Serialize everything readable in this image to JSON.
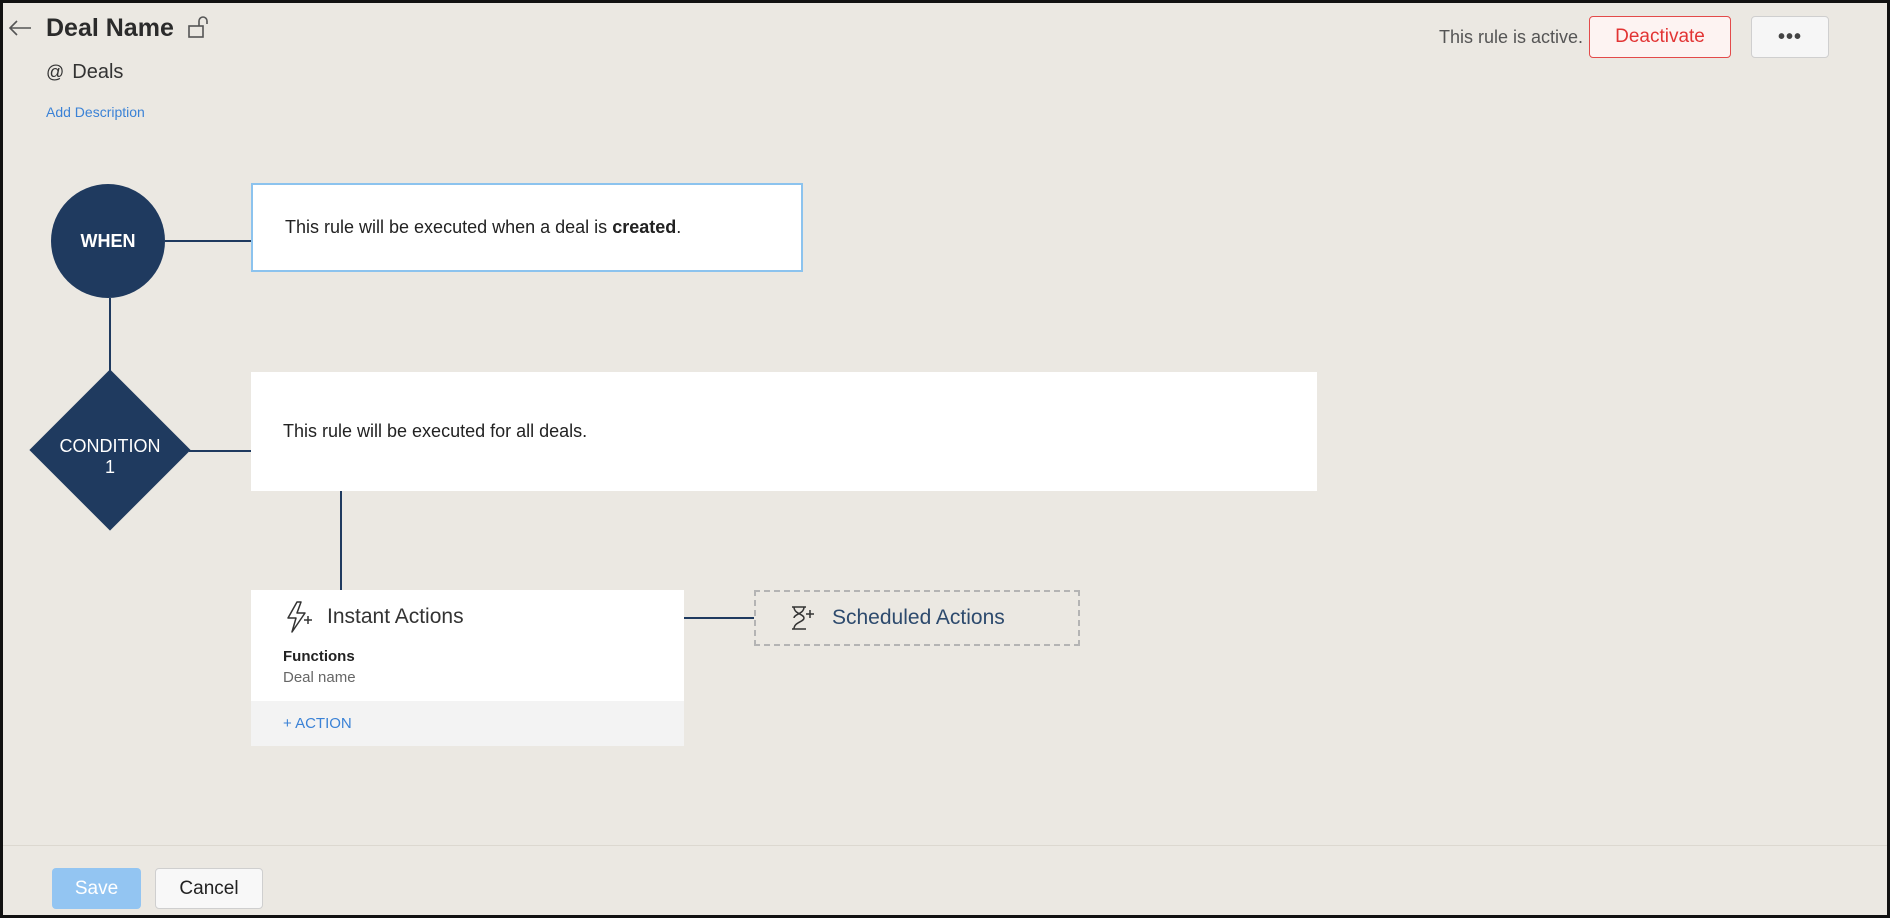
{
  "header": {
    "title": "Deal Name",
    "module_prefix": "@",
    "module": "Deals",
    "add_description": "Add Description",
    "status_text": "This rule is active.",
    "deactivate_label": "Deactivate",
    "more_label": "•••"
  },
  "flow": {
    "when_label": "WHEN",
    "when_text_before": "This rule will be executed when a deal is ",
    "when_text_bold": "created",
    "when_text_after": ".",
    "condition_label_line1": "CONDITION",
    "condition_label_line2": "1",
    "condition_text": "This rule will be executed for all deals.",
    "instant_actions": {
      "title": "Instant Actions",
      "functions_title": "Functions",
      "function_name": "Deal name",
      "add_action": "+ ACTION"
    },
    "scheduled_actions": {
      "title": "Scheduled Actions"
    }
  },
  "footer": {
    "save_label": "Save",
    "cancel_label": "Cancel"
  },
  "colors": {
    "node": "#1f3a5f",
    "link": "#3b82d6",
    "danger": "#e23434",
    "save": "#93c5f2"
  },
  "icons": {
    "back": "back-arrow-icon",
    "lock": "unlock-icon",
    "instant": "lightning-plus-icon",
    "scheduled": "hourglass-plus-icon"
  }
}
